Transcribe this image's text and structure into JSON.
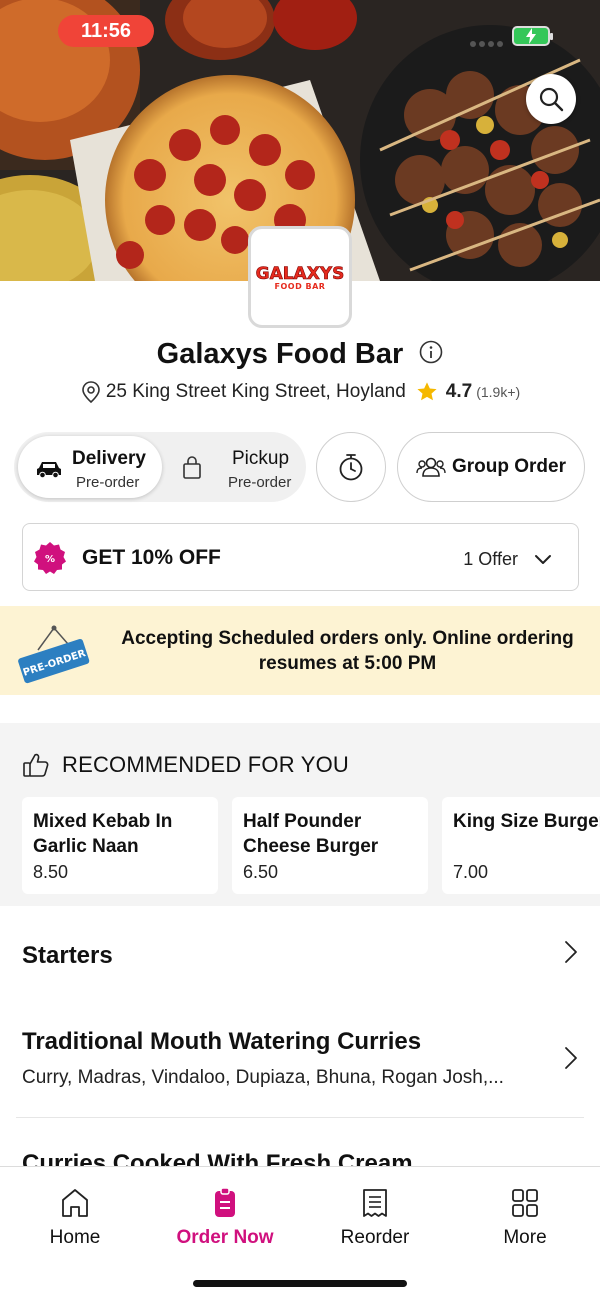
{
  "status_bar": {
    "time": "11:56"
  },
  "hero": {
    "search_icon": "search-icon",
    "logo": {
      "main": "GALAXYS",
      "sub": "FOOD BAR"
    }
  },
  "restaurant": {
    "name": "Galaxys Food Bar",
    "address": "25 King Street King Street, Hoyland",
    "rating": "4.7",
    "rating_count": "(1.9k+)"
  },
  "order_mode": {
    "delivery": {
      "label": "Delivery",
      "sub": "Pre-order"
    },
    "pickup": {
      "label": "Pickup",
      "sub": "Pre-order"
    },
    "selected": "delivery",
    "group_order_label": "Group Order"
  },
  "offer": {
    "title": "GET 10% OFF",
    "count": "1 Offer"
  },
  "preorder_banner": {
    "tag": "PRE-ORDER",
    "message": "Accepting Scheduled orders only. Online ordering resumes at 5:00 PM"
  },
  "recommended": {
    "heading": "RECOMMENDED FOR YOU",
    "items": [
      {
        "name": "Mixed Kebab In Garlic Naan",
        "price": "8.50"
      },
      {
        "name": "Half Pounder Cheese Burger",
        "price": "6.50"
      },
      {
        "name": "King Size Burger",
        "price": "7.00"
      }
    ]
  },
  "categories": [
    {
      "title": "Starters",
      "description": ""
    },
    {
      "title": "Traditional Mouth Watering Curries",
      "description": "Curry, Madras, Vindaloo, Dupiaza, Bhuna, Rogan Josh,..."
    },
    {
      "title": "Curries Cooked With Fresh Cream",
      "description": ""
    }
  ],
  "tabbar": {
    "items": [
      {
        "label": "Home",
        "icon": "home-icon"
      },
      {
        "label": "Order Now",
        "icon": "order-icon"
      },
      {
        "label": "Reorder",
        "icon": "receipt-icon"
      },
      {
        "label": "More",
        "icon": "grid-icon"
      }
    ],
    "active": "Order Now"
  },
  "colors": {
    "accent": "#d0107e",
    "banner_bg": "#fdf3d3",
    "status_pill": "#f04438",
    "star": "#f5b800"
  }
}
